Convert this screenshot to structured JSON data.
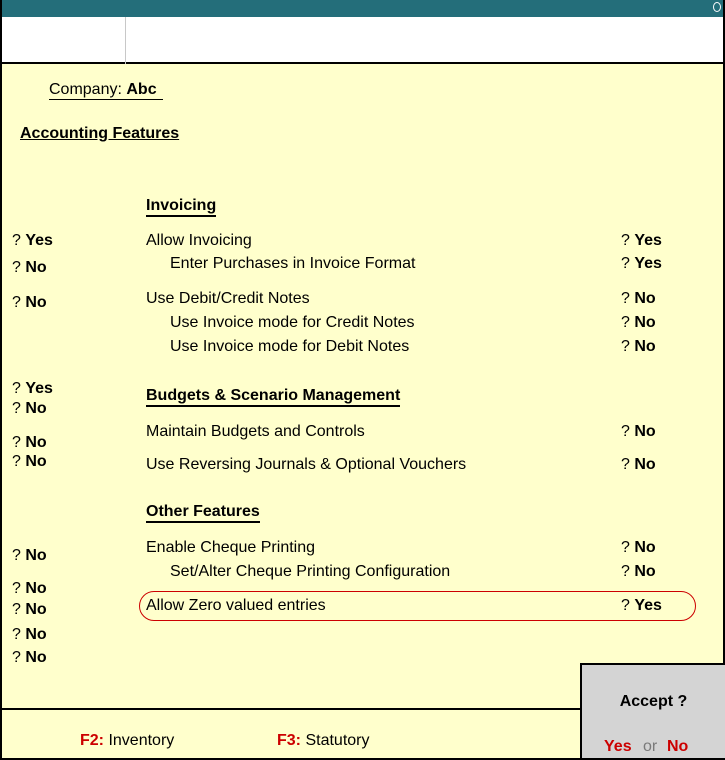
{
  "company": {
    "label": "Company:",
    "name": "Abc"
  },
  "page_heading": "Accounting Features",
  "left_column": [
    "? Yes",
    "? No",
    "? No",
    "? Yes",
    "? No",
    "? No",
    "? No",
    "? No",
    "? No",
    "? No",
    "? No",
    "? No"
  ],
  "sections": {
    "invoicing": {
      "title": "Invoicing",
      "items": [
        {
          "label": "Allow Invoicing",
          "value": "? Yes"
        },
        {
          "label": "Enter Purchases in Invoice Format",
          "value": "? Yes"
        },
        {
          "label": "Use Debit/Credit Notes",
          "value": "? No"
        },
        {
          "label": "Use Invoice mode for Credit Notes",
          "value": "? No"
        },
        {
          "label": "Use Invoice mode for Debit Notes",
          "value": "? No"
        }
      ]
    },
    "budgets": {
      "title": "Budgets & Scenario Management",
      "items": [
        {
          "label": "Maintain Budgets and Controls",
          "value": "? No"
        },
        {
          "label": "Use Reversing Journals & Optional Vouchers",
          "value": "? No"
        }
      ]
    },
    "other": {
      "title": "Other Features",
      "items": [
        {
          "label": "Enable Cheque Printing",
          "value": "? No"
        },
        {
          "label": "Set/Alter Cheque Printing Configuration",
          "value": "? No"
        },
        {
          "label": "Allow Zero valued entries",
          "value": "? Yes"
        }
      ]
    }
  },
  "footer": {
    "f2_key": "F2:",
    "f2_label": "Inventory",
    "f3_key": "F3:",
    "f3_label": "Statutory"
  },
  "accept": {
    "title": "Accept ?",
    "yes": "Yes",
    "or": "or",
    "no": "No"
  },
  "colors": {
    "header": "#246e7a",
    "background": "#ffffcc",
    "accent_red": "#cc0000",
    "dialog": "#d4d4d4"
  }
}
